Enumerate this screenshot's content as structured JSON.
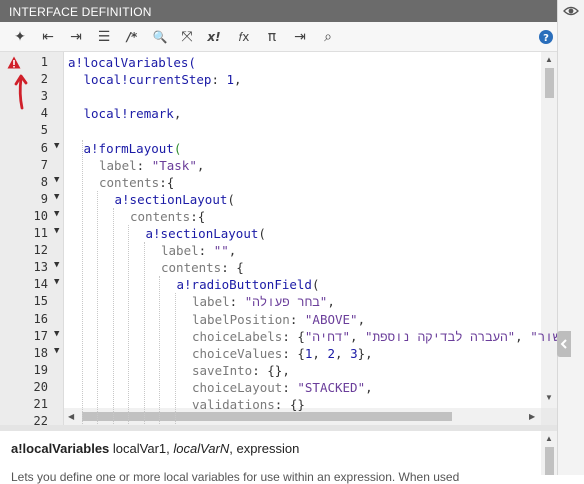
{
  "panel": {
    "title": "INTERFACE DEFINITION"
  },
  "toolbar": {
    "items": [
      {
        "name": "magic-wand-icon",
        "glyph": "✦"
      },
      {
        "name": "outdent-icon",
        "glyph": "⇤"
      },
      {
        "name": "indent-icon",
        "glyph": "⇥"
      },
      {
        "name": "format-list-icon",
        "glyph": "☰"
      },
      {
        "name": "comment-icon",
        "glyph": "/*"
      },
      {
        "name": "search-icon",
        "glyph": "🔍"
      },
      {
        "name": "expand-icon",
        "glyph": "⤧"
      },
      {
        "name": "expression-x-icon",
        "glyph": "x!"
      },
      {
        "name": "function-icon",
        "glyph": "𝑓x"
      },
      {
        "name": "pi-icon",
        "glyph": "π"
      },
      {
        "name": "export-icon",
        "glyph": "⇥"
      },
      {
        "name": "data-search-icon",
        "glyph": "⌕"
      }
    ],
    "help_glyph": "?"
  },
  "editor": {
    "lines": [
      {
        "num": "1",
        "fold": false,
        "indent": 0,
        "tokens": [
          {
            "t": "a!localVariables(",
            "c": "#1a1aa6"
          }
        ]
      },
      {
        "num": "2",
        "fold": false,
        "indent": 1,
        "tokens": [
          {
            "t": "local!currentStep",
            "c": "#1a1aa6"
          },
          {
            "t": ": ",
            "c": "#333333"
          },
          {
            "t": "1",
            "c": "#1a1aa6"
          },
          {
            "t": ",",
            "c": "#333333"
          }
        ]
      },
      {
        "num": "3",
        "fold": false,
        "indent": 0,
        "tokens": []
      },
      {
        "num": "4",
        "fold": false,
        "indent": 1,
        "tokens": [
          {
            "t": "local!remark",
            "c": "#1a1aa6"
          },
          {
            "t": ",",
            "c": "#333333"
          }
        ]
      },
      {
        "num": "5",
        "fold": false,
        "indent": 0,
        "tokens": []
      },
      {
        "num": "6",
        "fold": true,
        "indent": 1,
        "tokens": [
          {
            "t": "a!formLayout",
            "c": "#1a1aa6"
          },
          {
            "t": "(",
            "c": "#2e8b2e"
          }
        ]
      },
      {
        "num": "7",
        "fold": false,
        "indent": 2,
        "tokens": [
          {
            "t": "label",
            "c": "#7a7a7a"
          },
          {
            "t": ": ",
            "c": "#333333"
          },
          {
            "t": "\"Task\"",
            "c": "#6a3d9a"
          },
          {
            "t": ",",
            "c": "#333333"
          }
        ]
      },
      {
        "num": "8",
        "fold": true,
        "indent": 2,
        "tokens": [
          {
            "t": "contents",
            "c": "#7a7a7a"
          },
          {
            "t": ":{",
            "c": "#333333"
          }
        ]
      },
      {
        "num": "9",
        "fold": true,
        "indent": 3,
        "tokens": [
          {
            "t": "a!sectionLayout",
            "c": "#1a1aa6"
          },
          {
            "t": "(",
            "c": "#333333"
          }
        ]
      },
      {
        "num": "10",
        "fold": true,
        "indent": 4,
        "tokens": [
          {
            "t": "contents",
            "c": "#7a7a7a"
          },
          {
            "t": ":{",
            "c": "#333333"
          }
        ]
      },
      {
        "num": "11",
        "fold": true,
        "indent": 5,
        "tokens": [
          {
            "t": "a!sectionLayout",
            "c": "#1a1aa6"
          },
          {
            "t": "(",
            "c": "#333333"
          }
        ]
      },
      {
        "num": "12",
        "fold": false,
        "indent": 6,
        "tokens": [
          {
            "t": "label",
            "c": "#7a7a7a"
          },
          {
            "t": ": ",
            "c": "#333333"
          },
          {
            "t": "\"\"",
            "c": "#6a3d9a"
          },
          {
            "t": ",",
            "c": "#333333"
          }
        ]
      },
      {
        "num": "13",
        "fold": true,
        "indent": 6,
        "tokens": [
          {
            "t": "contents",
            "c": "#7a7a7a"
          },
          {
            "t": ": {",
            "c": "#333333"
          }
        ]
      },
      {
        "num": "14",
        "fold": true,
        "indent": 7,
        "tokens": [
          {
            "t": "a!radioButtonField",
            "c": "#1a1aa6"
          },
          {
            "t": "(",
            "c": "#333333"
          }
        ]
      },
      {
        "num": "15",
        "fold": false,
        "indent": 8,
        "tokens": [
          {
            "t": "label",
            "c": "#7a7a7a"
          },
          {
            "t": ": ",
            "c": "#333333"
          },
          {
            "t": "\"בחר פעולה\"",
            "c": "#6a3d9a"
          },
          {
            "t": ",",
            "c": "#333333"
          }
        ]
      },
      {
        "num": "16",
        "fold": false,
        "indent": 8,
        "tokens": [
          {
            "t": "labelPosition",
            "c": "#7a7a7a"
          },
          {
            "t": ": ",
            "c": "#333333"
          },
          {
            "t": "\"ABOVE\"",
            "c": "#6a3d9a"
          },
          {
            "t": ",",
            "c": "#333333"
          }
        ]
      },
      {
        "num": "17",
        "fold": true,
        "indent": 8,
        "tokens": [
          {
            "t": "choiceLabels",
            "c": "#7a7a7a"
          },
          {
            "t": ": {",
            "c": "#333333"
          },
          {
            "t": "\"דחיה\"",
            "c": "#6a3d9a"
          },
          {
            "t": ", ",
            "c": "#333333"
          },
          {
            "t": "\"העברה לבדיקה נוספת\"",
            "c": "#6a3d9a"
          },
          {
            "t": ", ",
            "c": "#333333"
          },
          {
            "t": "\"אישור\"",
            "c": "#6a3d9a"
          }
        ]
      },
      {
        "num": "18",
        "fold": true,
        "indent": 8,
        "tokens": [
          {
            "t": "choiceValues",
            "c": "#7a7a7a"
          },
          {
            "t": ": {",
            "c": "#333333"
          },
          {
            "t": "1",
            "c": "#1a1aa6"
          },
          {
            "t": ", ",
            "c": "#333333"
          },
          {
            "t": "2",
            "c": "#1a1aa6"
          },
          {
            "t": ", ",
            "c": "#333333"
          },
          {
            "t": "3",
            "c": "#1a1aa6"
          },
          {
            "t": "},",
            "c": "#333333"
          }
        ]
      },
      {
        "num": "19",
        "fold": false,
        "indent": 8,
        "tokens": [
          {
            "t": "saveInto",
            "c": "#7a7a7a"
          },
          {
            "t": ": {},",
            "c": "#333333"
          }
        ]
      },
      {
        "num": "20",
        "fold": false,
        "indent": 8,
        "tokens": [
          {
            "t": "choiceLayout",
            "c": "#7a7a7a"
          },
          {
            "t": ": ",
            "c": "#333333"
          },
          {
            "t": "\"STACKED\"",
            "c": "#6a3d9a"
          },
          {
            "t": ",",
            "c": "#333333"
          }
        ]
      },
      {
        "num": "21",
        "fold": false,
        "indent": 8,
        "tokens": [
          {
            "t": "validations",
            "c": "#7a7a7a"
          },
          {
            "t": ": {}",
            "c": "#333333"
          }
        ]
      },
      {
        "num": "22",
        "fold": false,
        "indent": 7,
        "tokens": []
      }
    ]
  },
  "documentation": {
    "fn_name": "a!localVariables",
    "params_plain": " localVar1, ",
    "param_italic": "localVarN",
    "params_rest": ", expression",
    "description": "Lets you define one or more local variables for use within an expression. When used"
  },
  "colors": {
    "title_bg": "#6b6b6b",
    "error_red": "#d0202a",
    "help_blue": "#2a6ebb"
  }
}
